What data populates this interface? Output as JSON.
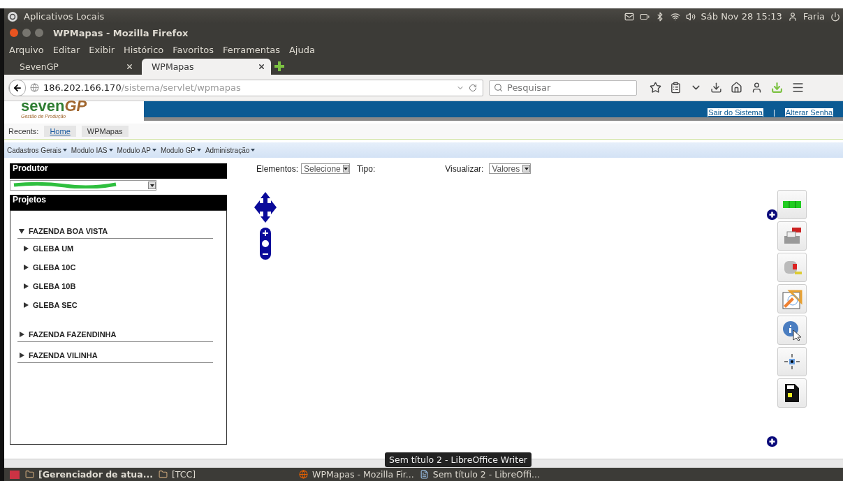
{
  "desktop_panel": {
    "title": "Aplicativos Locais",
    "clock": "Sáb Nov 28 15:13",
    "user": "Faria"
  },
  "window": {
    "title": "WPMapas - Mozilla Firefox"
  },
  "menu_bar": [
    "Arquivo",
    "Editar",
    "Exibir",
    "Histórico",
    "Favoritos",
    "Ferramentas",
    "Ajuda"
  ],
  "browser_tabs": [
    {
      "label": "SevenGP",
      "selected": false
    },
    {
      "label": "WPMapas",
      "selected": true
    }
  ],
  "address_bar": {
    "host": "186.202.166.170",
    "path": "/sistema/servlet/wpmapas"
  },
  "search": {
    "placeholder": "Pesquisar"
  },
  "site_header": {
    "logo_word": "seven",
    "logo_suffix": "GP",
    "logo_tagline": "Gestão de Produção",
    "links": [
      "Sair do Sistema",
      "Alterar Senha"
    ],
    "separator": "|"
  },
  "recents": {
    "label": "Recents:",
    "items": [
      {
        "label": "Home",
        "link": true
      },
      {
        "label": "WPMapas",
        "link": false
      }
    ]
  },
  "site_menu": [
    "Cadastros Gerais",
    "Modulo IAS",
    "Modulo AP",
    "Modulo GP",
    "Administração"
  ],
  "left_panel": {
    "producer_heading": "Produtor",
    "projects_heading": "Projetos",
    "tree": [
      {
        "label": "FAZENDA BOA VISTA",
        "expanded": true,
        "children": [
          {
            "label": "GLEBA UM",
            "expanded": false
          },
          {
            "label": "GLEBA 10C",
            "expanded": false
          },
          {
            "label": "GLEBA 10B",
            "expanded": false
          },
          {
            "label": "GLEBA SEC",
            "expanded": false
          }
        ]
      },
      {
        "label": "FAZENDA FAZENDINHA",
        "expanded": false
      },
      {
        "label": "FAZENDA VILINHA",
        "expanded": false
      }
    ]
  },
  "filters": {
    "elements_label": "Elementos:",
    "elements_value": "Selecione",
    "type_label": "Tipo:",
    "view_label": "Visualizar:",
    "view_value": "Valores"
  },
  "tooltip": "Sem título 2 - LibreOffice Writer",
  "taskbar": [
    {
      "label": "[Gerenciador de atua...",
      "kind": "folder"
    },
    {
      "label": "[TCC]",
      "kind": "folder"
    },
    {
      "label": "WPMapas - Mozilla Fir...",
      "kind": "browser"
    },
    {
      "label": "Sem título 2 - LibreOffi...",
      "kind": "document"
    }
  ]
}
